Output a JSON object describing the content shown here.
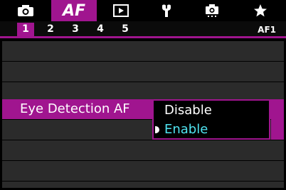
{
  "tabs": [
    {
      "name": "shooting",
      "icon": "camera-icon",
      "label": ""
    },
    {
      "name": "af",
      "icon": "",
      "label": "AF",
      "active": true
    },
    {
      "name": "playback",
      "icon": "playback-icon",
      "label": ""
    },
    {
      "name": "setup",
      "icon": "wrench-icon",
      "label": ""
    },
    {
      "name": "custom",
      "icon": "custom-camera-icon",
      "label": ""
    },
    {
      "name": "mymenu",
      "icon": "star-icon",
      "label": ""
    }
  ],
  "subtabs": [
    "1",
    "2",
    "3",
    "4",
    "5"
  ],
  "active_subtab": "1",
  "page_code": "AF1",
  "menu": {
    "selected_item_label": "Eye Detection AF"
  },
  "dropdown": {
    "options": [
      "Disable",
      "Enable"
    ],
    "selected": "Enable"
  },
  "colors": {
    "accent": "#a0158f",
    "row_bg": "#2b2b2b",
    "selected_text": "#4fe3f0"
  }
}
